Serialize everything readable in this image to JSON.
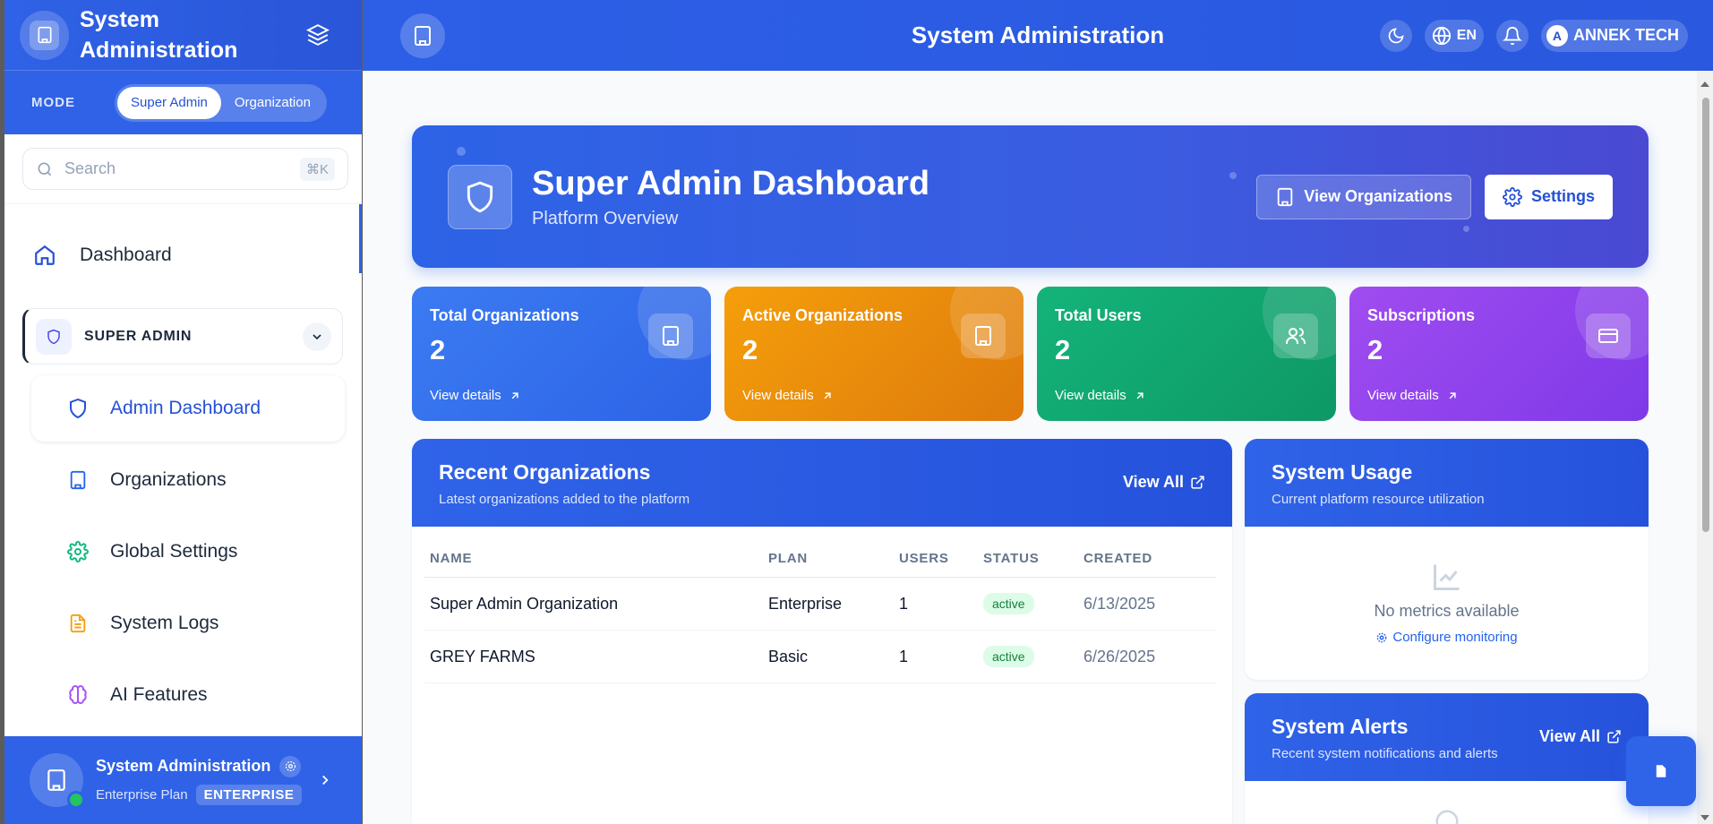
{
  "sidebar": {
    "title": "System Administration",
    "mode_label": "MODE",
    "mode_options": [
      "Super Admin",
      "Organization"
    ],
    "search_placeholder": "Search",
    "search_shortcut": "⌘K",
    "dashboard_label": "Dashboard",
    "group_label": "SUPER ADMIN",
    "items": [
      {
        "label": "Admin Dashboard",
        "icon": "shield-icon"
      },
      {
        "label": "Organizations",
        "icon": "building-icon"
      },
      {
        "label": "Global Settings",
        "icon": "gear-icon"
      },
      {
        "label": "System Logs",
        "icon": "file-text-icon"
      },
      {
        "label": "AI Features",
        "icon": "brain-icon"
      }
    ],
    "footer": {
      "name": "System Administration",
      "plan": "Enterprise Plan",
      "badge": "ENTERPRISE"
    }
  },
  "topbar": {
    "title": "System Administration",
    "language": "EN",
    "avatar_initial": "A",
    "user": "ANNEK TECH"
  },
  "hero": {
    "title": "Super Admin Dashboard",
    "subtitle": "Platform Overview",
    "view_orgs": "View Organizations",
    "settings": "Settings"
  },
  "stats": [
    {
      "label": "Total Organizations",
      "value": "2",
      "link": "View details",
      "color": "#3572ee"
    },
    {
      "label": "Active Organizations",
      "value": "2",
      "link": "View details",
      "color": "#ee8a0c"
    },
    {
      "label": "Total Users",
      "value": "2",
      "link": "View details",
      "color": "#12a472"
    },
    {
      "label": "Subscriptions",
      "value": "2",
      "link": "View details",
      "color": "#9143ee"
    }
  ],
  "recent": {
    "title": "Recent Organizations",
    "subtitle": "Latest organizations added to the platform",
    "view_all": "View All",
    "columns": [
      "NAME",
      "PLAN",
      "USERS",
      "STATUS",
      "CREATED"
    ],
    "rows": [
      {
        "name": "Super Admin Organization",
        "plan": "Enterprise",
        "users": "1",
        "status": "active",
        "created": "6/13/2025"
      },
      {
        "name": "GREY FARMS",
        "plan": "Basic",
        "users": "1",
        "status": "active",
        "created": "6/26/2025"
      }
    ]
  },
  "usage": {
    "title": "System Usage",
    "subtitle": "Current platform resource utilization",
    "empty": "No metrics available",
    "configure": "Configure monitoring"
  },
  "alerts": {
    "title": "System Alerts",
    "subtitle": "Recent system notifications and alerts",
    "view_all": "View All"
  }
}
